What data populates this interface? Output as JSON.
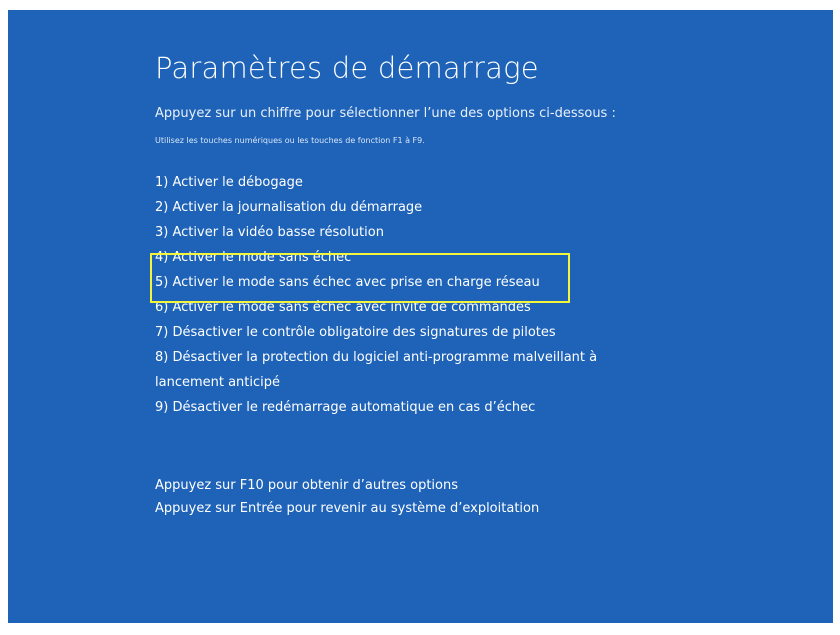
{
  "colors": {
    "background": "#1e63b8",
    "highlight": "#f3f53a",
    "text": "#ffffff"
  },
  "title": "Paramètres de démarrage",
  "instruction": "Appuyez sur un chiffre pour sélectionner l’une des options ci-dessous :",
  "hint": "Utilisez les touches numériques ou les touches de fonction F1 à F9.",
  "options": [
    "1) Activer le débogage",
    "2) Activer la journalisation du démarrage",
    "3) Activer la vidéo basse résolution",
    "4) Activer le mode sans échec",
    "5) Activer le mode sans échec avec prise en charge réseau",
    "6) Activer le mode sans échec avec invite de commandes",
    "7) Désactiver le contrôle obligatoire des signatures de pilotes",
    "8) Désactiver la protection du logiciel anti-programme malveillant à lancement anticipé",
    "9) Désactiver le redémarrage automatique en cas d’échec"
  ],
  "footer": {
    "more_options": "Appuyez sur F10 pour obtenir d’autres options",
    "return": "Appuyez sur Entrée pour revenir au système d’exploitation"
  }
}
